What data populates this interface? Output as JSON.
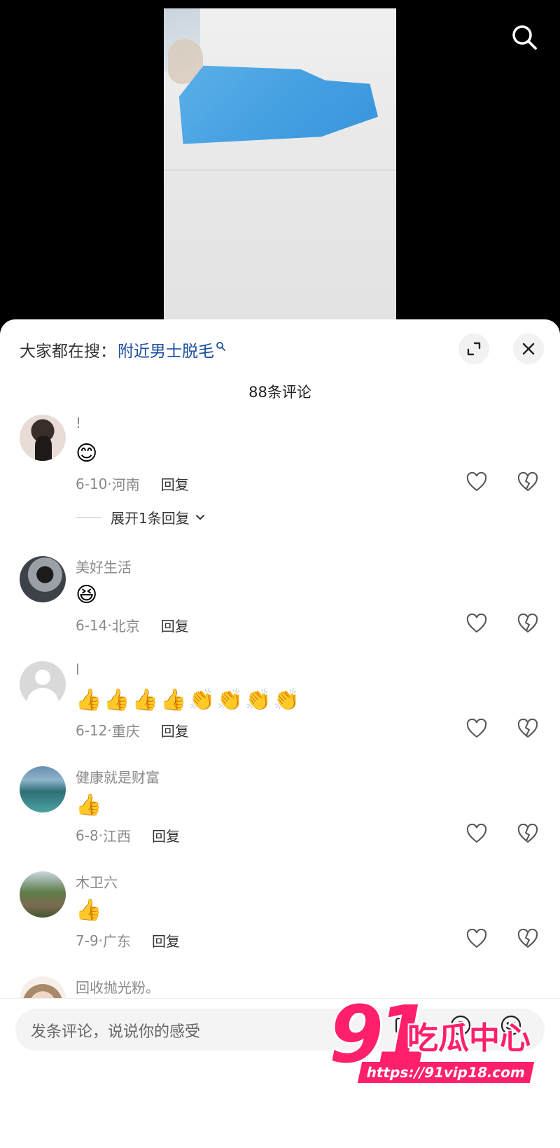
{
  "hot_search": {
    "prefix": "大家都在搜：",
    "term": "附近男士脱毛"
  },
  "comment_count_title": "88条评论",
  "comments": [
    {
      "username": "!",
      "emojis": [
        "😊"
      ],
      "date": "6-10",
      "location": "河南",
      "reply_label": "回复",
      "expand_label": "展开1条回复",
      "avatar": "woman-portrait-avatar"
    },
    {
      "username": "美好生活",
      "emojis": [
        "😆"
      ],
      "date": "6-14",
      "location": "北京",
      "reply_label": "回复",
      "avatar": "man-with-car-avatar"
    },
    {
      "username": "l",
      "emojis": [
        "👍",
        "👍",
        "👍",
        "👍",
        "👏",
        "👏",
        "👏",
        "👏"
      ],
      "date": "6-12",
      "location": "重庆",
      "reply_label": "回复",
      "avatar": "default-avatar"
    },
    {
      "username": "健康就是财富",
      "emojis": [
        "👍"
      ],
      "date": "6-8",
      "location": "江西",
      "reply_label": "回复",
      "avatar": "lake-landscape-avatar"
    },
    {
      "username": "木卫六",
      "emojis": [
        "👍"
      ],
      "date": "7-9",
      "location": "广东",
      "reply_label": "回复",
      "avatar": "garden-landscape-avatar"
    },
    {
      "username": "回收抛光粉。",
      "avatar": "woman-face-avatar"
    }
  ],
  "comment_input": {
    "placeholder": "发条评论，说说你的感受"
  },
  "watermark": {
    "logo_text": "91吃瓜中心",
    "url": "https://91vip18.com"
  },
  "colors": {
    "hot_search_term": "#1c4fa0",
    "watermark": "#ff1f6b",
    "secondary_text": "#8a8a8a"
  }
}
